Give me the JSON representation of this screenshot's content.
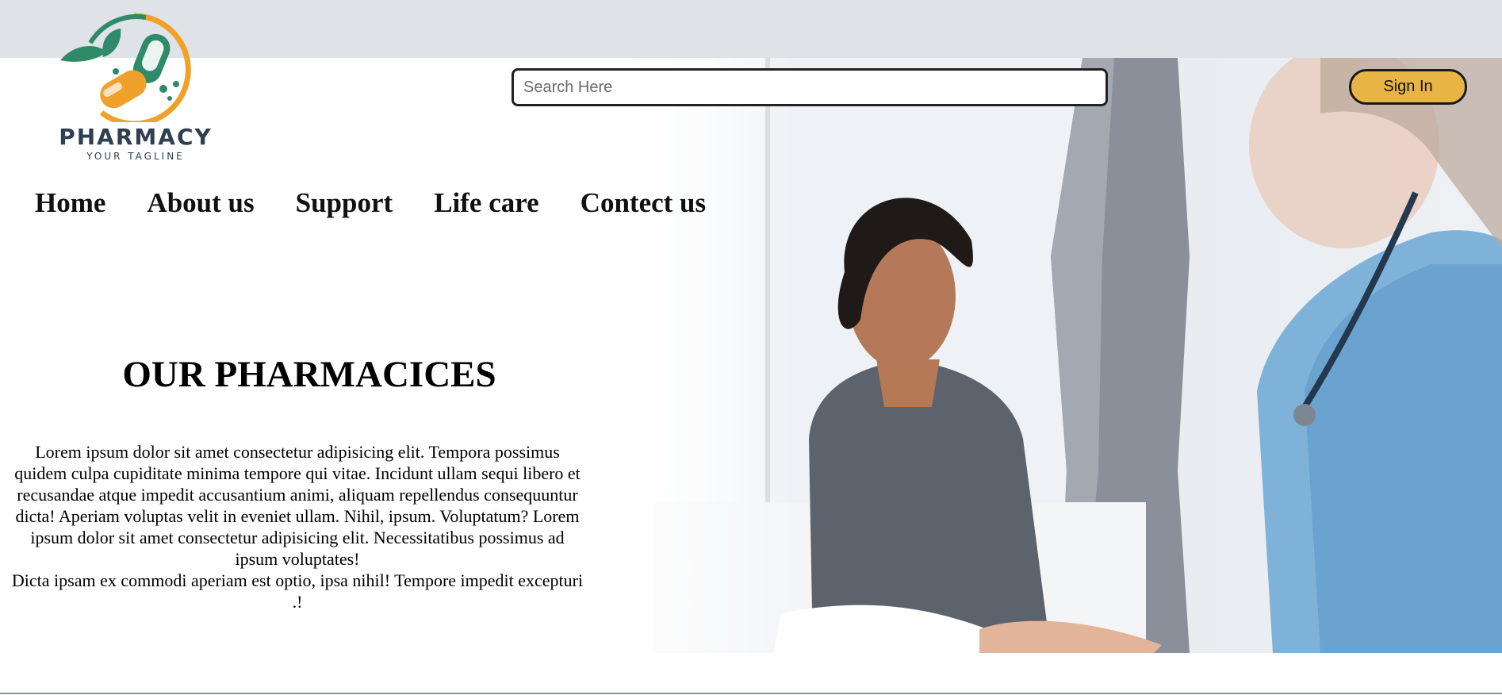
{
  "brand": {
    "name": "PHARMACY",
    "tagline": "YOUR TAGLINE"
  },
  "search": {
    "placeholder": "Search Here",
    "value": ""
  },
  "header": {
    "signin_label": "Sign In"
  },
  "nav": {
    "items": [
      {
        "label": "Home"
      },
      {
        "label": "About us"
      },
      {
        "label": "Support"
      },
      {
        "label": "Life care"
      },
      {
        "label": "Contect us"
      }
    ]
  },
  "hero": {
    "title": "OUR PHARMACICES",
    "paragraph_1": "Lorem ipsum dolor sit amet consectetur adipisicing elit. Tempora possimus quidem culpa cupiditate minima tempore qui vitae. Incidunt ullam sequi libero et recusandae atque impedit accusantium animi, aliquam repellendus consequuntur dicta! Aperiam voluptas velit in eveniet ullam. Nihil, ipsum. Voluptatum? Lorem ipsum dolor sit amet consectetur adipisicing elit. Necessitatibus possimus ad ipsum voluptates!",
    "paragraph_2": "Dicta ipsam ex commodi aperiam est optio, ipsa nihil! Tempore impedit excepturi .!"
  },
  "colors": {
    "topbar": "#dfe2e7",
    "signin_button": "#e8b445",
    "logo_green": "#2e8b6a",
    "logo_orange": "#f0a12a",
    "logo_text": "#2e3f4e"
  },
  "images": {
    "hero_photo": "patient-and-nurse-photo"
  }
}
